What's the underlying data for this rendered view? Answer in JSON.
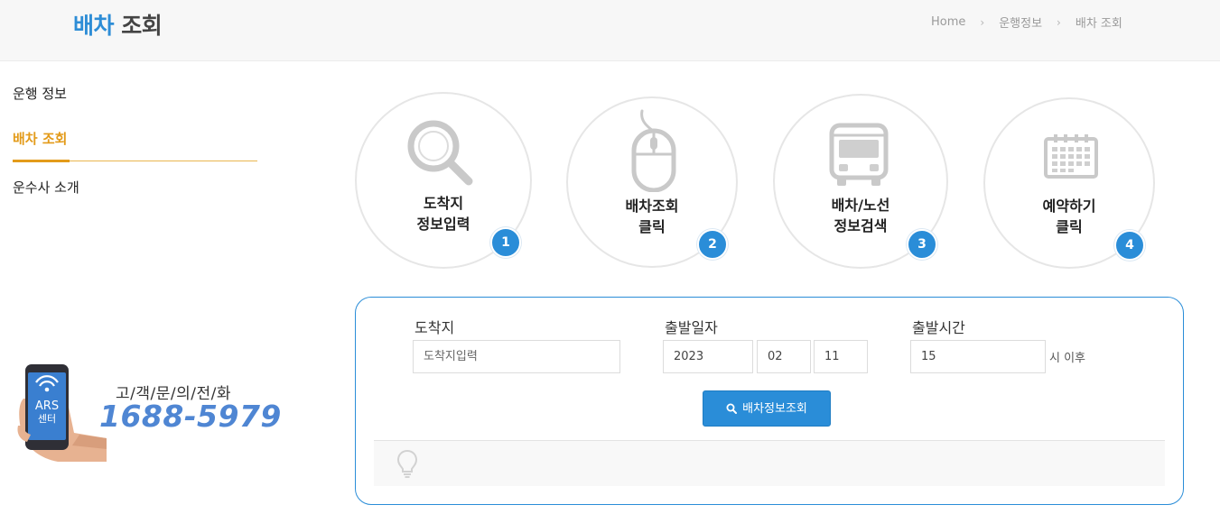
{
  "header": {
    "title_accent": "배차",
    "title_rest": "조회",
    "breadcrumb": [
      "Home",
      "운행정보",
      "배차 조회"
    ]
  },
  "sidebar": {
    "items": [
      {
        "label": "운행 정보"
      },
      {
        "label": "배차 조회",
        "active": true
      },
      {
        "label": "운수사 소개"
      }
    ]
  },
  "ars": {
    "screen_line1": "ARS",
    "screen_line2": "센터",
    "label": "고/객/문/의/전/화",
    "phone": "1688-5979"
  },
  "steps": [
    {
      "line1": "도착지",
      "line2": "정보입력",
      "number": "1",
      "icon": "search-icon"
    },
    {
      "line1": "배차조회",
      "line2": "클릭",
      "number": "2",
      "icon": "mouse-icon"
    },
    {
      "line1": "배차/노선",
      "line2": "정보검색",
      "number": "3",
      "icon": "bus-icon"
    },
    {
      "line1": "예약하기",
      "line2": "클릭",
      "number": "4",
      "icon": "calendar-icon"
    }
  ],
  "search": {
    "destination_label": "도착지",
    "destination_placeholder": "도착지입력",
    "date_label": "출발일자",
    "year": "2023",
    "month": "02",
    "day": "11",
    "time_label": "출발시간",
    "hour": "15",
    "time_suffix": "시 이후",
    "button_label": "배차정보조회"
  },
  "colors": {
    "accent_blue": "#2a8dd8",
    "active_orange": "#e39b1a"
  }
}
